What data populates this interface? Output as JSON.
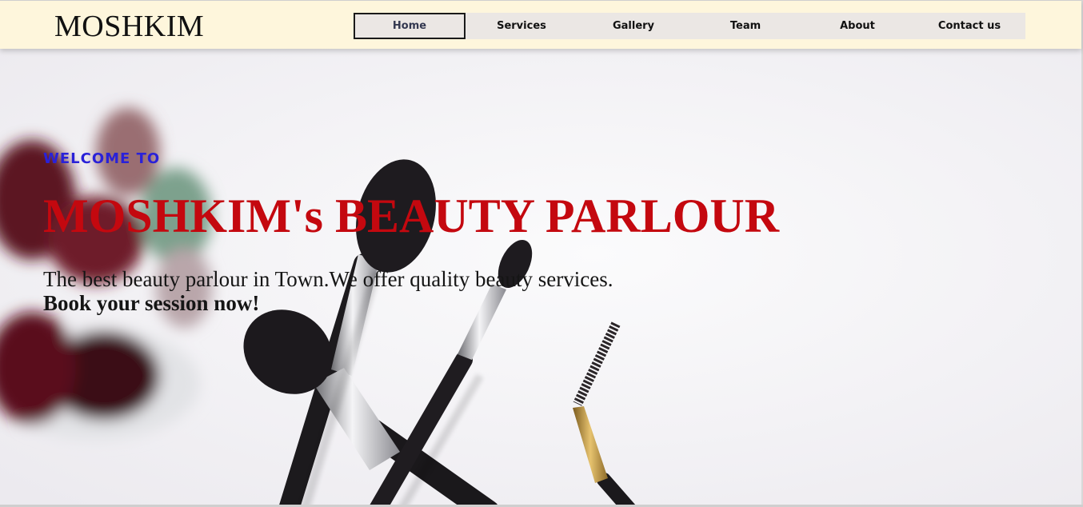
{
  "header": {
    "brand": "MOSHKIM",
    "nav": [
      {
        "label": "Home",
        "active": true
      },
      {
        "label": "Services",
        "active": false
      },
      {
        "label": "Gallery",
        "active": false
      },
      {
        "label": "Team",
        "active": false
      },
      {
        "label": "About",
        "active": false
      },
      {
        "label": "Contact us",
        "active": false
      }
    ]
  },
  "hero": {
    "eyebrow": "WELCOME TO",
    "title": "MOSHKIM's BEAUTY PARLOUR",
    "tagline": "The best beauty parlour in Town.We offer quality beauty services.",
    "cta": "Book your session now!",
    "image": "makeup-brushes-photo"
  },
  "colors": {
    "nav_bg": "#fef6dc",
    "menu_bg": "#ebe7e4",
    "eyebrow": "#2a21d8",
    "title": "#c4080f",
    "text": "#151515"
  }
}
